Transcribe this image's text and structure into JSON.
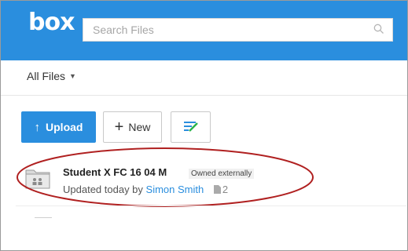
{
  "header": {
    "logo": "box",
    "search_placeholder": "Search Files"
  },
  "breadcrumb": {
    "label": "All Files"
  },
  "toolbar": {
    "upload_label": "Upload",
    "new_label": "New"
  },
  "files": [
    {
      "name": "Student X FC 16 04 M",
      "badge": "Owned externally",
      "updated_prefix": "Updated today by",
      "updated_by": "Simon Smith",
      "count": "2"
    }
  ],
  "colors": {
    "brand": "#2a8ede",
    "highlight": "#b02020"
  },
  "icons": [
    "search-icon",
    "chevron-down-icon",
    "arrow-up-icon",
    "plus-icon",
    "edit-icon",
    "shared-folder-icon",
    "document-icon"
  ]
}
